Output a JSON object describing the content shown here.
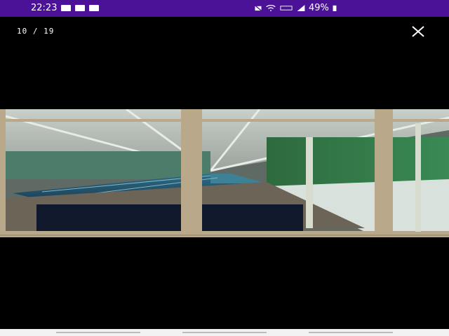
{
  "status_bar": {
    "time": "22:23",
    "battery_percent": "49%",
    "notification_icons": [
      "image-notification-icon",
      "mail-notification-icon",
      "message-notification-icon"
    ],
    "system_icons": [
      "mute-icon",
      "wifi-icon",
      "data-icon",
      "signal-icon",
      "battery-icon"
    ],
    "background": "#4b1196"
  },
  "viewer": {
    "counter": "10 / 19",
    "close_icon": "close-icon",
    "photo_subject": "indoor-swimming-pool-photo"
  },
  "nav_bar": {
    "buttons": [
      "recents-button",
      "home-button",
      "back-button"
    ]
  }
}
